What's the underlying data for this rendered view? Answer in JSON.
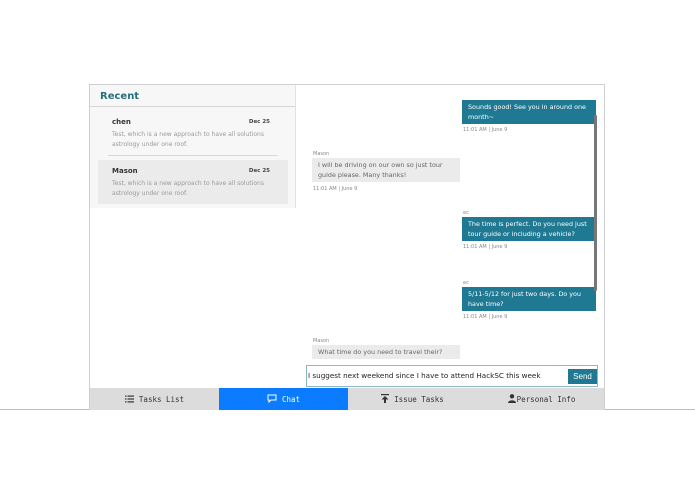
{
  "sidebar": {
    "title": "Recent",
    "conversations": [
      {
        "name": "chen",
        "date": "Dec 25",
        "preview": "Test, which is a new approach to have all solutions astrology under one roof."
      },
      {
        "name": "Mason",
        "date": "Dec 25",
        "preview": "Test, which is a new approach to have all solutions astrology under one roof."
      }
    ]
  },
  "messages": [
    {
      "direction": "out",
      "sender": "",
      "text": "Sounds good! See you in around one month~",
      "meta": "11:01 AM | June 9"
    },
    {
      "direction": "in",
      "sender": "Mason",
      "text": "I will be driving on our own so just tour guide please. Many thanks!",
      "meta": "11:01 AM | June 9"
    },
    {
      "direction": "out",
      "sender": "ec",
      "text": "The time is perfect. Do you need just tour guide or including a vehicle?",
      "meta": "11:01 AM | June 9"
    },
    {
      "direction": "out",
      "sender": "ec",
      "text": "5/11-5/12 for just two days. Do you have time?",
      "meta": "11:01 AM | June 9"
    },
    {
      "direction": "in",
      "sender": "Mason",
      "text": "What time do you need to travel their?",
      "meta": ""
    }
  ],
  "composer": {
    "value": "I suggest next weekend since I have to attend HackSC this week",
    "send_label": "Send"
  },
  "nav": {
    "items": [
      {
        "label": "Tasks List",
        "icon": "list-icon"
      },
      {
        "label": "Chat",
        "icon": "chat-icon",
        "active": true
      },
      {
        "label": "Issue Tasks",
        "icon": "upload-icon"
      },
      {
        "label": "Personal Info",
        "icon": "person-icon"
      }
    ]
  },
  "colors": {
    "accent": "#1f7993",
    "nav_active": "#0b7cff",
    "title": "#25707d"
  }
}
